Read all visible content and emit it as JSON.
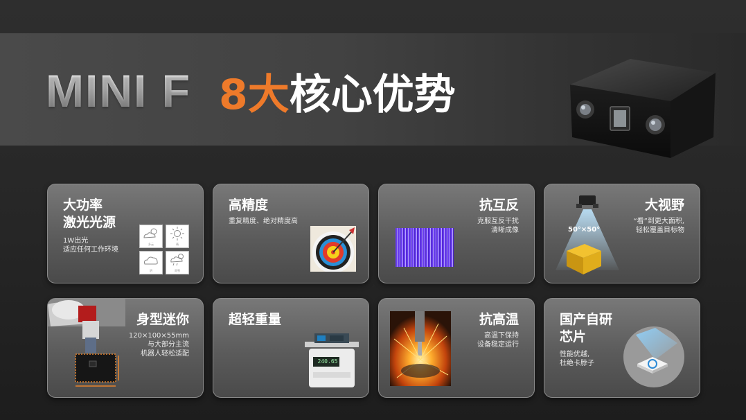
{
  "header": {
    "title_main": "MINI F",
    "title_number": "8大",
    "title_rest": "核心优势",
    "accent_color": "#ee7a2a"
  },
  "cards": [
    {
      "title_lines": [
        "大功率",
        "激光光源"
      ],
      "desc_lines": [
        "1W出光",
        "适应任何工作环境"
      ],
      "weather_labels": [
        "多云",
        "晴",
        "阴",
        "雨雪"
      ]
    },
    {
      "title_lines": [
        "高精度"
      ],
      "desc_lines": [
        "重复精度、绝对精度高"
      ]
    },
    {
      "title_lines": [
        "抗互反"
      ],
      "desc_lines": [
        "克服互反干扰",
        "清晰成像"
      ]
    },
    {
      "title_lines": [
        "大视野"
      ],
      "desc_lines": [
        "“看”到更大面积,",
        "轻松覆盖目标物"
      ],
      "fov_label": "50°×50°"
    },
    {
      "title_lines": [
        "身型迷你"
      ],
      "desc_lines": [
        "120×100×55mm",
        "与大部分主流",
        "机器人轻松适配"
      ]
    },
    {
      "title_lines": [
        "超轻重量"
      ],
      "desc_lines": [],
      "scale_reading": "240.65"
    },
    {
      "title_lines": [
        "抗高温"
      ],
      "desc_lines": [
        "高温下保持",
        "设备稳定运行"
      ]
    },
    {
      "title_lines": [
        "国产自研",
        "芯片"
      ],
      "desc_lines": [
        "性能优越,",
        "杜绝卡脖子"
      ]
    }
  ]
}
